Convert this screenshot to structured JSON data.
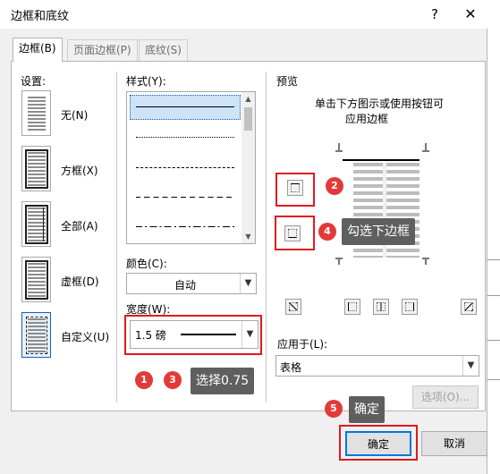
{
  "window": {
    "title": "边框和底纹",
    "help_label": "?",
    "close_label": "✕"
  },
  "tabs": [
    {
      "label": "边框(B)",
      "active": true
    },
    {
      "label": "页面边框(P)",
      "active": false
    },
    {
      "label": "底纹(S)",
      "active": false
    }
  ],
  "settings": {
    "heading": "设置:",
    "items": [
      {
        "label": "无(N)",
        "icon": "none-setting-icon"
      },
      {
        "label": "方框(X)",
        "icon": "box-setting-icon"
      },
      {
        "label": "全部(A)",
        "icon": "all-setting-icon"
      },
      {
        "label": "虚框(D)",
        "icon": "grid-setting-icon"
      },
      {
        "label": "自定义(U)",
        "icon": "custom-setting-icon",
        "selected": true
      }
    ]
  },
  "style": {
    "heading": "样式(Y):",
    "options": [
      "solid",
      "dotted",
      "dashed",
      "dashed-wide",
      "dash-dot"
    ]
  },
  "color": {
    "heading": "颜色(C):",
    "value": "自动"
  },
  "width": {
    "heading": "宽度(W):",
    "value": "1.5 磅"
  },
  "preview": {
    "heading": "预览",
    "hint_line1": "单击下方图示或使用按钮可",
    "hint_line2": "应用边框"
  },
  "apply_to": {
    "heading": "应用于(L):",
    "value": "表格"
  },
  "buttons": {
    "options": "选项(O)...",
    "ok": "确定",
    "cancel": "取消"
  },
  "annotations": {
    "badges": [
      "1",
      "2",
      "3",
      "4",
      "5"
    ],
    "callout_width": "选择0.75",
    "callout_bottom_border": "勾选下边框",
    "callout_ok": "确定"
  },
  "colors": {
    "highlight": "#e0191f",
    "badge": "#e23a3a",
    "callout": "#5f5f5f",
    "selected_setting": "#1a5fb4"
  }
}
